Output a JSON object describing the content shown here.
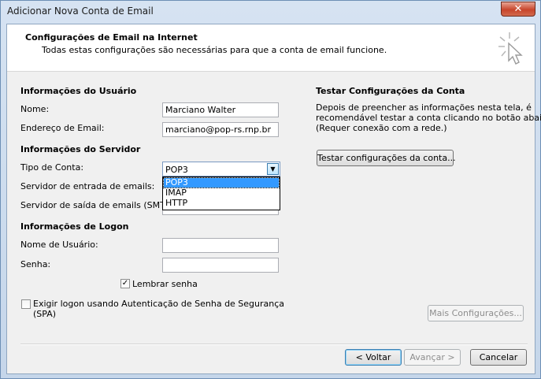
{
  "window": {
    "title": "Adicionar Nova Conta de Email",
    "close_glyph": "✕"
  },
  "header": {
    "title": "Configurações de Email na Internet",
    "subtitle": "Todas estas configurações são necessárias para que a conta de email funcione."
  },
  "user_info": {
    "heading": "Informações do Usuário",
    "name_label": "Nome:",
    "name_value": "Marciano Walter",
    "email_label": "Endereço de Email:",
    "email_value": "marciano@pop-rs.rnp.br"
  },
  "server_info": {
    "heading": "Informações do Servidor",
    "account_type_label": "Tipo de Conta:",
    "account_type_value": "POP3",
    "account_type_options": [
      "POP3",
      "IMAP",
      "HTTP"
    ],
    "incoming_label": "Servidor de entrada de emails:",
    "outgoing_label": "Servidor de saída de emails (SMTP):"
  },
  "logon_info": {
    "heading": "Informações de Logon",
    "username_label": "Nome de Usuário:",
    "username_value": "",
    "password_label": "Senha:",
    "password_value": "",
    "remember_label": "Lembrar senha",
    "remember_checked": true,
    "spa_label_line1": "Exigir logon usando Autenticação de Senha de Segurança",
    "spa_label_line2": "(SPA)",
    "spa_checked": false
  },
  "test_settings": {
    "heading": "Testar Configurações da Conta",
    "description_line1": "Depois de preencher as informações nesta tela, é",
    "description_line2": "recomendável testar a conta clicando no botão abaixo.",
    "description_line3": "(Requer conexão com a rede.)",
    "test_button": "Testar configurações da conta..."
  },
  "buttons": {
    "more_settings": "Mais Configurações...",
    "back": "< Voltar",
    "next": "Avançar >",
    "cancel": "Cancelar"
  },
  "check_glyph": "✓",
  "dropdown_glyph": "▼"
}
